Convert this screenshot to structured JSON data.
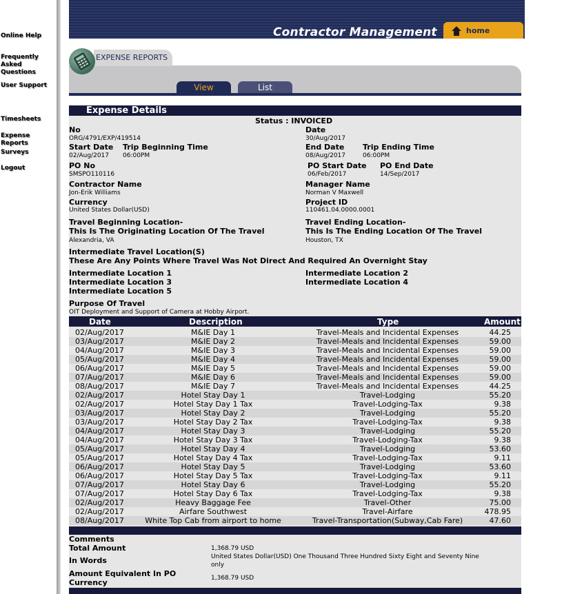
{
  "sidebar": {
    "items": [
      {
        "label": "Online Help"
      },
      {
        "label": "Frequently Asked Questions"
      },
      {
        "label": "User Support"
      },
      {
        "label": "Timesheets"
      },
      {
        "label": "Expense Reports"
      },
      {
        "label": "Surveys"
      },
      {
        "label": "Logout"
      }
    ]
  },
  "header": {
    "title": "Contractor Management",
    "home_label": "home"
  },
  "section": {
    "title": "EXPENSE REPORTS",
    "tabs": [
      {
        "label": "View"
      },
      {
        "label": "List"
      }
    ]
  },
  "details": {
    "header": "Expense Details",
    "status": "Status : INVOICED",
    "no_label": "No",
    "no_value": "ORG/4791/EXP/419514",
    "date_label": "Date",
    "date_value": "30/Aug/2017",
    "start_date_label": "Start Date",
    "start_date_value": "02/Aug/2017",
    "trip_begin_time_label": "Trip Beginning Time",
    "trip_begin_time_value": "06:00PM",
    "end_date_label": "End Date",
    "end_date_value": "08/Aug/2017",
    "trip_end_time_label": "Trip Ending Time",
    "trip_end_time_value": "06:00PM",
    "po_no_label": "PO No",
    "po_no_value": "SMSPO110116",
    "po_start_label": "PO Start Date",
    "po_start_value": "06/Feb/2017",
    "po_end_label": "PO End Date",
    "po_end_value": "14/Sep/2017",
    "contractor_label": "Contractor Name",
    "contractor_value": "Jon-Erik Williams",
    "manager_label": "Manager Name",
    "manager_value": "Norman V Maxwell",
    "currency_label": "Currency",
    "currency_value": "United States Dollar(USD)",
    "project_label": "Project ID",
    "project_value": "110461.04.0000.0001",
    "travel_begin_label": "Travel Beginning Location-",
    "travel_begin_sub": "This Is The Originating Location Of The Travel",
    "travel_begin_value": "Alexandria, VA",
    "travel_end_label": "Travel Ending Location-",
    "travel_end_sub": "This Is The Ending Location Of The Travel",
    "travel_end_value": "Houston, TX",
    "intermediate_label": "Intermediate Travel Location(S)",
    "intermediate_sub": "These Are Any Points Where Travel Was Not Direct And Required An Overnight Stay",
    "int1": "Intermediate Location 1",
    "int2": "Intermediate Location 2",
    "int3": "Intermediate Location 3",
    "int4": "Intermediate Location 4",
    "int5": "Intermediate Location 5",
    "purpose_label": "Purpose Of Travel",
    "purpose_value": "OIT Deployment and Support of Camera at Hobby Airport."
  },
  "table": {
    "headers": {
      "date": "Date",
      "description": "Description",
      "type": "Type",
      "amount": "Amount"
    },
    "rows": [
      {
        "date": "02/Aug/2017",
        "description": "M&IE Day 1",
        "type": "Travel-Meals and Incidental Expenses",
        "amount": "44.25"
      },
      {
        "date": "03/Aug/2017",
        "description": "M&IE Day 2",
        "type": "Travel-Meals and Incidental Expenses",
        "amount": "59.00"
      },
      {
        "date": "04/Aug/2017",
        "description": "M&IE Day 3",
        "type": "Travel-Meals and Incidental Expenses",
        "amount": "59.00"
      },
      {
        "date": "05/Aug/2017",
        "description": "M&IE Day 4",
        "type": "Travel-Meals and Incidental Expenses",
        "amount": "59.00"
      },
      {
        "date": "06/Aug/2017",
        "description": "M&IE Day 5",
        "type": "Travel-Meals and Incidental Expenses",
        "amount": "59.00"
      },
      {
        "date": "07/Aug/2017",
        "description": "M&IE Day 6",
        "type": "Travel-Meals and Incidental Expenses",
        "amount": "59.00"
      },
      {
        "date": "08/Aug/2017",
        "description": "M&IE Day 7",
        "type": "Travel-Meals and Incidental Expenses",
        "amount": "44.25"
      },
      {
        "date": "02/Aug/2017",
        "description": "Hotel Stay Day 1",
        "type": "Travel-Lodging",
        "amount": "55.20"
      },
      {
        "date": "02/Aug/2017",
        "description": "Hotel Stay Day 1 Tax",
        "type": "Travel-Lodging-Tax",
        "amount": "9.38"
      },
      {
        "date": "03/Aug/2017",
        "description": "Hotel Stay Day 2",
        "type": "Travel-Lodging",
        "amount": "55.20"
      },
      {
        "date": "03/Aug/2017",
        "description": "Hotel Stay Day 2 Tax",
        "type": "Travel-Lodging-Tax",
        "amount": "9.38"
      },
      {
        "date": "04/Aug/2017",
        "description": "Hotel Stay Day 3",
        "type": "Travel-Lodging",
        "amount": "55.20"
      },
      {
        "date": "04/Aug/2017",
        "description": "Hotel Stay Day 3 Tax",
        "type": "Travel-Lodging-Tax",
        "amount": "9.38"
      },
      {
        "date": "05/Aug/2017",
        "description": "Hotel Stay Day 4",
        "type": "Travel-Lodging",
        "amount": "53.60"
      },
      {
        "date": "05/Aug/2017",
        "description": "Hotel Stay Day 4 Tax",
        "type": "Travel-Lodging-Tax",
        "amount": "9.11"
      },
      {
        "date": "06/Aug/2017",
        "description": "Hotel Stay Day 5",
        "type": "Travel-Lodging",
        "amount": "53.60"
      },
      {
        "date": "06/Aug/2017",
        "description": "Hotel Stay Day 5 Tax",
        "type": "Travel-Lodging-Tax",
        "amount": "9.11"
      },
      {
        "date": "07/Aug/2017",
        "description": "Hotel Stay Day 6",
        "type": "Travel-Lodging",
        "amount": "55.20"
      },
      {
        "date": "07/Aug/2017",
        "description": "Hotel Stay Day 6 Tax",
        "type": "Travel-Lodging-Tax",
        "amount": "9.38"
      },
      {
        "date": "02/Aug/2017",
        "description": "Heavy Baggage Fee",
        "type": "Travel-Other",
        "amount": "75.00"
      },
      {
        "date": "02/Aug/2017",
        "description": "Airfare Southwest",
        "type": "Travel-Airfare",
        "amount": "478.95"
      },
      {
        "date": "08/Aug/2017",
        "description": "White Top Cab from airport to home",
        "type": "Travel-Transportation(Subway,Cab Fare)",
        "amount": "47.60"
      }
    ]
  },
  "summary": {
    "comments_label": "Comments",
    "total_label": "Total Amount",
    "total_value": "1,368.79 USD",
    "words_label": "In Words",
    "words_value_line1": "United States Dollar(USD)  One Thousand Three Hundred Sixty Eight and Seventy Nine",
    "words_value_line2": "only",
    "equiv_label_line1": "Amount Equivalent In PO",
    "equiv_label_line2": "Currency",
    "equiv_value": "1,368.79 USD"
  },
  "colors": {
    "navy": "#16193a",
    "banner": "#1f2a55",
    "accent": "#e8a31a",
    "panel": "#e6e6e6"
  }
}
